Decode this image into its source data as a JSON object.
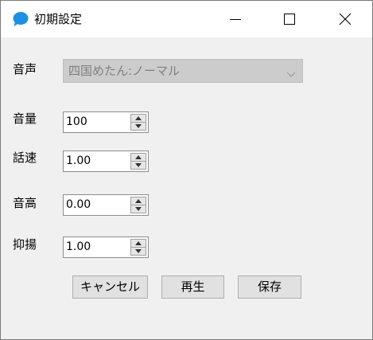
{
  "window": {
    "title": "初期設定",
    "icon": "speech-bubble-icon",
    "controls": [
      "minimize-icon",
      "maximize-icon",
      "close-icon"
    ]
  },
  "form": {
    "voice": {
      "label": "音声",
      "value": "四国めたん:ノーマル"
    },
    "volume": {
      "label": "音量",
      "value": "100"
    },
    "speed": {
      "label": "話速",
      "value": "1.00"
    },
    "pitch": {
      "label": "音高",
      "value": "0.00"
    },
    "intonation": {
      "label": "抑揚",
      "value": "1.00"
    }
  },
  "buttons": {
    "cancel": "キャンセル",
    "play": "再生",
    "save": "保存"
  },
  "colors": {
    "accent": "#1e8fe1",
    "background": "#f0f0f0",
    "disabled_combo": "#cccccc"
  }
}
